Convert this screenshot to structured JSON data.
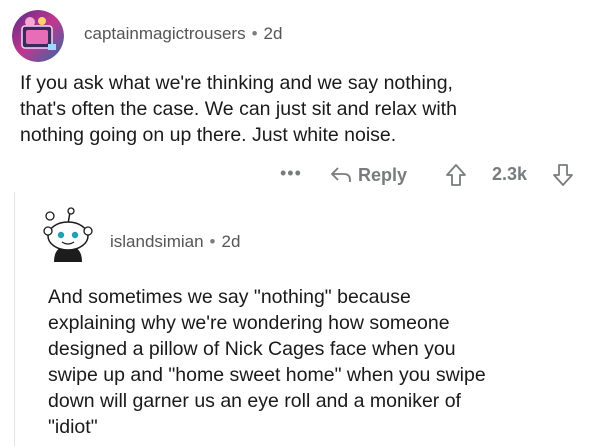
{
  "top_comment": {
    "username": "captainmagictrousers",
    "separator": "•",
    "age": "2d",
    "body": "If you ask what we're thinking and we say nothing,\nthat's often the case. We can just sit and relax with\nnothing going on up there. Just white noise.",
    "actions": {
      "more_label": "•••",
      "reply_label": "Reply",
      "score": "2.3k"
    }
  },
  "reply_comment": {
    "username": "islandsimian",
    "separator": "•",
    "age": "2d",
    "body": "And sometimes we say \"nothing\" because\nexplaining why we're wondering how someone\ndesigned a pillow of Nick Cages face when you\nswipe up and \"home sweet home\" when you swipe\ndown will garner us an eye roll and a moniker of\n\"idiot\""
  },
  "icons": {
    "top_avatar": "user-avatar-image",
    "reply_avatar": "snoo-avatar",
    "more": "more-options-icon",
    "reply": "reply-arrow-icon",
    "upvote": "upvote-arrow-icon",
    "downvote": "downvote-arrow-icon"
  },
  "colors": {
    "meta_text": "#555555",
    "action_gray": "#787c7e",
    "body_text": "#1a1a1b"
  }
}
